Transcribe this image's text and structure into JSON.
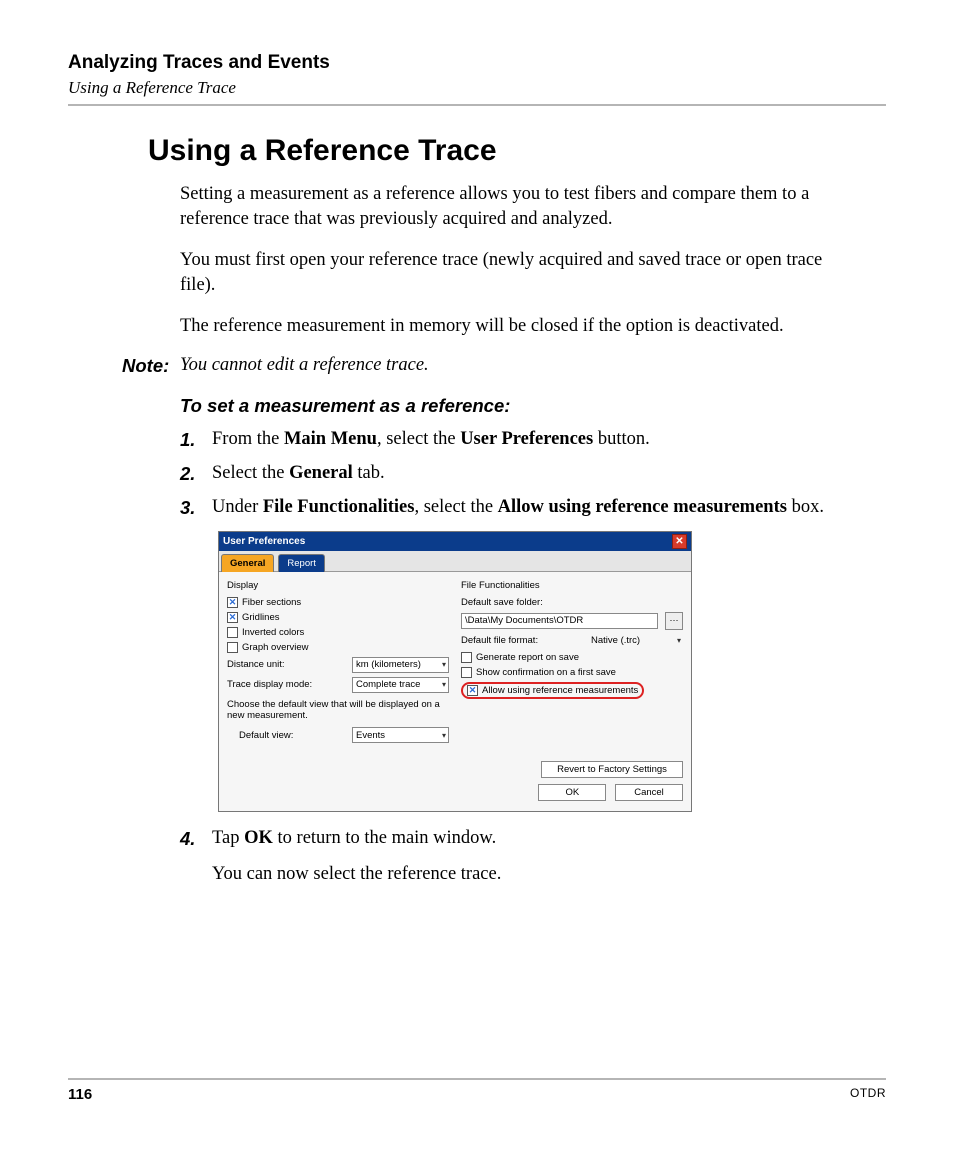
{
  "header": {
    "chapter": "Analyzing Traces and Events",
    "section": "Using a Reference Trace"
  },
  "heading": "Using a Reference Trace",
  "paragraphs": {
    "p1": "Setting a measurement as a reference allows you to test fibers and compare them to a reference trace that was previously acquired and analyzed.",
    "p2": "You must first open your reference trace (newly acquired and saved trace or open trace file).",
    "p3": "The reference measurement in memory will be closed if the option is deactivated."
  },
  "note": {
    "label": "Note:",
    "text": "You cannot edit a reference trace."
  },
  "task_heading": "To set a measurement as a reference:",
  "steps": {
    "s1": {
      "num": "1.",
      "pre": "From the ",
      "b1": "Main Menu",
      "mid": ", select the ",
      "b2": "User Preferences",
      "post": " button."
    },
    "s2": {
      "num": "2.",
      "pre": "Select the ",
      "b1": "General",
      "post": " tab."
    },
    "s3": {
      "num": "3.",
      "pre": "Under ",
      "b1": "File Functionalities",
      "mid": ", select the ",
      "b2": "Allow using reference measurements",
      "post": " box."
    },
    "s4": {
      "num": "4.",
      "pre": "Tap ",
      "b1": "OK",
      "post": " to return to the main window.",
      "sub": "You can now select the reference trace."
    }
  },
  "screenshot": {
    "title": "User Preferences",
    "close_glyph": "✕",
    "tabs": {
      "general": "General",
      "report": "Report"
    },
    "left": {
      "group": "Display",
      "fiber_sections": "Fiber sections",
      "gridlines": "Gridlines",
      "inverted_colors": "Inverted colors",
      "graph_overview": "Graph overview",
      "distance_unit_label": "Distance unit:",
      "distance_unit_value": "km (kilometers)",
      "trace_mode_label": "Trace display mode:",
      "trace_mode_value": "Complete trace",
      "default_hint": "Choose the default view that will be displayed on a new measurement.",
      "default_view_label": "Default view:",
      "default_view_value": "Events"
    },
    "right": {
      "group": "File Functionalities",
      "default_folder_label": "Default save folder:",
      "default_folder_value": "\\Data\\My Documents\\OTDR",
      "default_format_label": "Default file format:",
      "default_format_value": "Native (.trc)",
      "gen_report": "Generate report on save",
      "show_confirm": "Show confirmation on a first save",
      "allow_ref": "Allow using reference measurements"
    },
    "footer": {
      "revert": "Revert to Factory Settings",
      "ok": "OK",
      "cancel": "Cancel"
    },
    "checked_glyph": "✕"
  },
  "footer": {
    "page": "116",
    "product": "OTDR"
  }
}
